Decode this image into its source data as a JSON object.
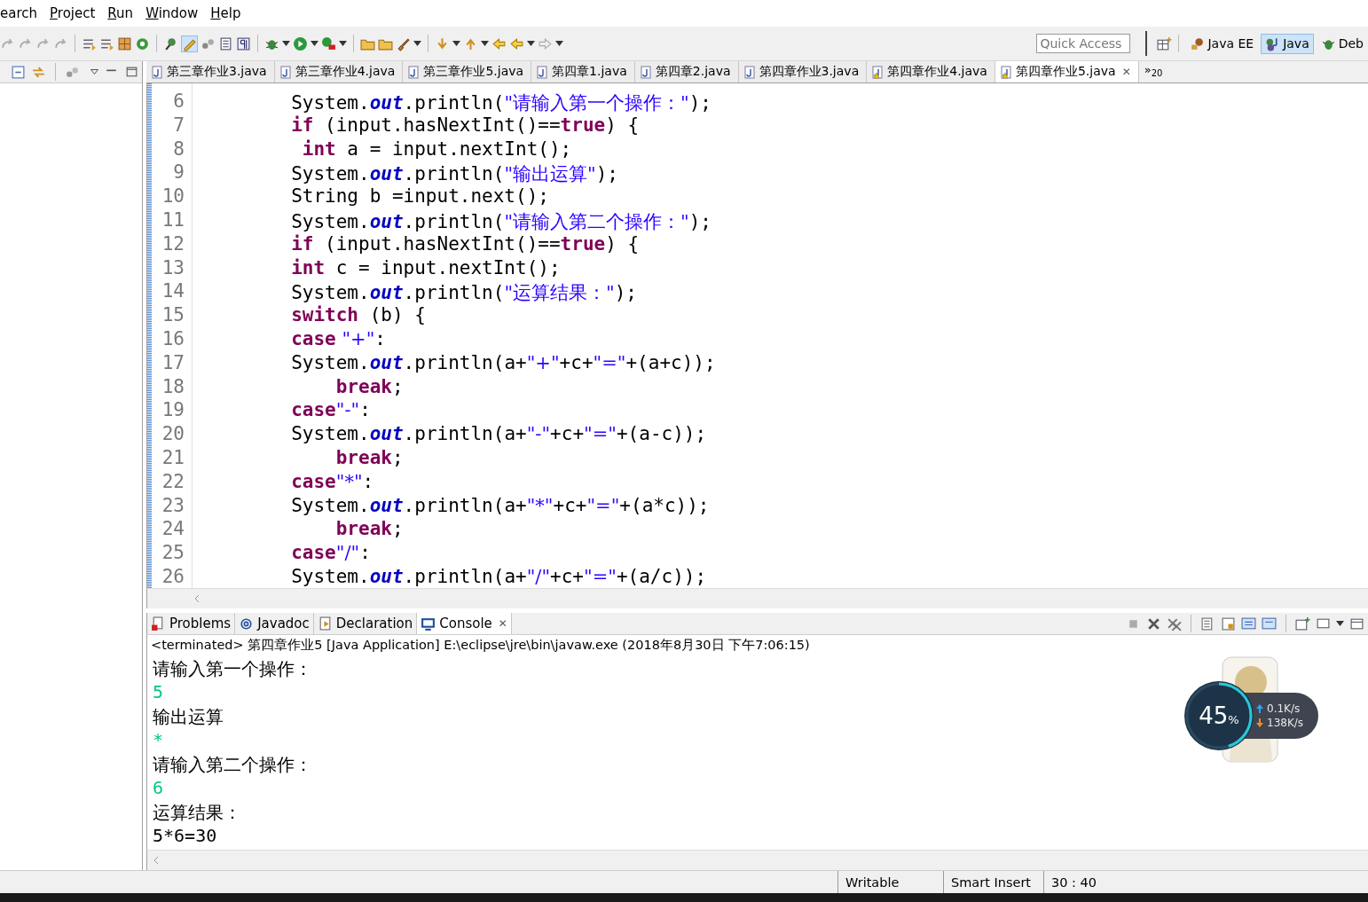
{
  "menu": [
    {
      "label": "earch",
      "mnemonic": false
    },
    {
      "label": "Project",
      "mnemonic": true
    },
    {
      "label": "Run",
      "mnemonic": true
    },
    {
      "label": "Window",
      "mnemonic": true
    },
    {
      "label": "Help",
      "mnemonic": true
    }
  ],
  "quick_access": {
    "placeholder": "Quick Access"
  },
  "perspectives": [
    {
      "label": "Java EE",
      "selected": false
    },
    {
      "label": "Java",
      "selected": true
    },
    {
      "label": "Deb",
      "selected": false
    }
  ],
  "editor_tabs": [
    {
      "label": "第三章作业3.java",
      "selected": false,
      "warning": false
    },
    {
      "label": "第三章作业4.java",
      "selected": false,
      "warning": false
    },
    {
      "label": "第三章作业5.java",
      "selected": false,
      "warning": false
    },
    {
      "label": "第四章1.java",
      "selected": false,
      "warning": false
    },
    {
      "label": "第四章2.java",
      "selected": false,
      "warning": false
    },
    {
      "label": "第四章作业3.java",
      "selected": false,
      "warning": false
    },
    {
      "label": "第四章作业4.java",
      "selected": false,
      "warning": true
    },
    {
      "label": "第四章作业5.java",
      "selected": true,
      "warning": true,
      "close": "✕"
    }
  ],
  "overflow_tabs": {
    "symbol": "»",
    "count": "20"
  },
  "code_lines": [
    {
      "number": "6",
      "segments": [
        {
          "text": "        System.",
          "kind": "plain"
        },
        {
          "text": "out",
          "kind": "field"
        },
        {
          "text": ".println(",
          "kind": "plain"
        },
        {
          "text": "\"请输入第一个操作：\"",
          "kind": "str"
        },
        {
          "text": ");",
          "kind": "plain"
        }
      ]
    },
    {
      "number": "7",
      "segments": [
        {
          "text": "        if",
          "kind": "kw"
        },
        {
          "text": " (input.hasNextInt()==",
          "kind": "plain"
        },
        {
          "text": "true",
          "kind": "kw"
        },
        {
          "text": ") {",
          "kind": "plain"
        }
      ]
    },
    {
      "number": "8",
      "segments": [
        {
          "text": "         int",
          "kind": "kw"
        },
        {
          "text": " a = input.nextInt();",
          "kind": "plain"
        }
      ]
    },
    {
      "number": "9",
      "segments": [
        {
          "text": "        System.",
          "kind": "plain"
        },
        {
          "text": "out",
          "kind": "field"
        },
        {
          "text": ".println(",
          "kind": "plain"
        },
        {
          "text": "\"输出运算\"",
          "kind": "str"
        },
        {
          "text": ");",
          "kind": "plain"
        }
      ]
    },
    {
      "number": "10",
      "segments": [
        {
          "text": "        String b =input.next();",
          "kind": "plain"
        }
      ]
    },
    {
      "number": "11",
      "segments": [
        {
          "text": "        System.",
          "kind": "plain"
        },
        {
          "text": "out",
          "kind": "field"
        },
        {
          "text": ".println(",
          "kind": "plain"
        },
        {
          "text": "\"请输入第二个操作：\"",
          "kind": "str"
        },
        {
          "text": ");",
          "kind": "plain"
        }
      ]
    },
    {
      "number": "12",
      "segments": [
        {
          "text": "        if",
          "kind": "kw"
        },
        {
          "text": " (input.hasNextInt()==",
          "kind": "plain"
        },
        {
          "text": "true",
          "kind": "kw"
        },
        {
          "text": ") {",
          "kind": "plain"
        }
      ]
    },
    {
      "number": "13",
      "segments": [
        {
          "text": "        int",
          "kind": "kw"
        },
        {
          "text": " c = input.nextInt();",
          "kind": "plain"
        }
      ]
    },
    {
      "number": "14",
      "segments": [
        {
          "text": "        System.",
          "kind": "plain"
        },
        {
          "text": "out",
          "kind": "field"
        },
        {
          "text": ".println(",
          "kind": "plain"
        },
        {
          "text": "\"运算结果：\"",
          "kind": "str"
        },
        {
          "text": ");",
          "kind": "plain"
        }
      ]
    },
    {
      "number": "15",
      "segments": [
        {
          "text": "        switch",
          "kind": "kw"
        },
        {
          "text": " (b) {",
          "kind": "plain"
        }
      ]
    },
    {
      "number": "16",
      "segments": [
        {
          "text": "        case",
          "kind": "kw"
        },
        {
          "text": " \"+\"",
          "kind": "str"
        },
        {
          "text": ":",
          "kind": "plain"
        }
      ]
    },
    {
      "number": "17",
      "segments": [
        {
          "text": "        System.",
          "kind": "plain"
        },
        {
          "text": "out",
          "kind": "field"
        },
        {
          "text": ".println(a+",
          "kind": "plain"
        },
        {
          "text": "\"+\"",
          "kind": "str"
        },
        {
          "text": "+c+",
          "kind": "plain"
        },
        {
          "text": "\"=\"",
          "kind": "str"
        },
        {
          "text": "+(a+c));",
          "kind": "plain"
        }
      ]
    },
    {
      "number": "18",
      "segments": [
        {
          "text": "            break",
          "kind": "kw"
        },
        {
          "text": ";",
          "kind": "plain"
        }
      ]
    },
    {
      "number": "19",
      "segments": [
        {
          "text": "        case",
          "kind": "kw"
        },
        {
          "text": "\"-\"",
          "kind": "str"
        },
        {
          "text": ":",
          "kind": "plain"
        }
      ]
    },
    {
      "number": "20",
      "segments": [
        {
          "text": "        System.",
          "kind": "plain"
        },
        {
          "text": "out",
          "kind": "field"
        },
        {
          "text": ".println(a+",
          "kind": "plain"
        },
        {
          "text": "\"-\"",
          "kind": "str"
        },
        {
          "text": "+c+",
          "kind": "plain"
        },
        {
          "text": "\"=\"",
          "kind": "str"
        },
        {
          "text": "+(a-c));",
          "kind": "plain"
        }
      ]
    },
    {
      "number": "21",
      "segments": [
        {
          "text": "            break",
          "kind": "kw"
        },
        {
          "text": ";",
          "kind": "plain"
        }
      ]
    },
    {
      "number": "22",
      "segments": [
        {
          "text": "        case",
          "kind": "kw"
        },
        {
          "text": "\"*\"",
          "kind": "str"
        },
        {
          "text": ":",
          "kind": "plain"
        }
      ]
    },
    {
      "number": "23",
      "segments": [
        {
          "text": "        System.",
          "kind": "plain"
        },
        {
          "text": "out",
          "kind": "field"
        },
        {
          "text": ".println(a+",
          "kind": "plain"
        },
        {
          "text": "\"*\"",
          "kind": "str"
        },
        {
          "text": "+c+",
          "kind": "plain"
        },
        {
          "text": "\"=\"",
          "kind": "str"
        },
        {
          "text": "+(a*c));",
          "kind": "plain"
        }
      ]
    },
    {
      "number": "24",
      "segments": [
        {
          "text": "            break",
          "kind": "kw"
        },
        {
          "text": ";",
          "kind": "plain"
        }
      ]
    },
    {
      "number": "25",
      "segments": [
        {
          "text": "        case",
          "kind": "kw"
        },
        {
          "text": "\"/\"",
          "kind": "str"
        },
        {
          "text": ":",
          "kind": "plain"
        }
      ]
    },
    {
      "number": "26",
      "segments": [
        {
          "text": "        System.",
          "kind": "plain"
        },
        {
          "text": "out",
          "kind": "field"
        },
        {
          "text": ".println(a+",
          "kind": "plain"
        },
        {
          "text": "\"/\"",
          "kind": "str"
        },
        {
          "text": "+c+",
          "kind": "plain"
        },
        {
          "text": "\"=\"",
          "kind": "str"
        },
        {
          "text": "+(a/c));",
          "kind": "plain"
        }
      ]
    }
  ],
  "bottom_tabs": [
    {
      "label": "Problems",
      "selected": false
    },
    {
      "label": "Javadoc",
      "selected": false
    },
    {
      "label": "Declaration",
      "selected": false
    },
    {
      "label": "Console",
      "selected": true,
      "close": "✕"
    }
  ],
  "console": {
    "header": "<terminated> 第四章作业5 [Java Application] E:\\eclipse\\jre\\bin\\javaw.exe (2018年8月30日 下午7:06:15)",
    "lines": [
      {
        "text": "请输入第一个操作：",
        "kind": "output"
      },
      {
        "text": "5",
        "kind": "input"
      },
      {
        "text": "输出运算",
        "kind": "output"
      },
      {
        "text": "*",
        "kind": "input"
      },
      {
        "text": "请输入第二个操作：",
        "kind": "output"
      },
      {
        "text": "6",
        "kind": "input"
      },
      {
        "text": "运算结果：",
        "kind": "output"
      },
      {
        "text": "5*6=30",
        "kind": "output"
      }
    ]
  },
  "network_meter": {
    "percent": "45",
    "unit": "%",
    "level": 0.45,
    "upload": "0.1K/s",
    "download": "138K/s"
  },
  "status_bar": [
    "Writable",
    "Smart Insert",
    "30 : 40"
  ]
}
